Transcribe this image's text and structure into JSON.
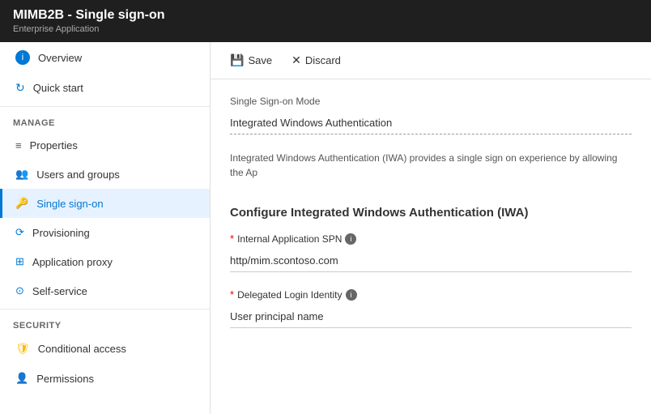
{
  "header": {
    "title": "MIMB2B - Single sign-on",
    "subtitle": "Enterprise Application"
  },
  "toolbar": {
    "save_label": "Save",
    "discard_label": "Discard"
  },
  "sidebar": {
    "items_top": [
      {
        "id": "overview",
        "label": "Overview",
        "icon": "info",
        "active": false
      },
      {
        "id": "quickstart",
        "label": "Quick start",
        "icon": "quickstart",
        "active": false
      }
    ],
    "manage_label": "MANAGE",
    "items_manage": [
      {
        "id": "properties",
        "label": "Properties",
        "icon": "bars",
        "active": false
      },
      {
        "id": "users-groups",
        "label": "Users and groups",
        "icon": "people",
        "active": false
      },
      {
        "id": "single-sign-on",
        "label": "Single sign-on",
        "icon": "sso",
        "active": true
      },
      {
        "id": "provisioning",
        "label": "Provisioning",
        "icon": "sync",
        "active": false
      },
      {
        "id": "application-proxy",
        "label": "Application proxy",
        "icon": "grid",
        "active": false
      },
      {
        "id": "self-service",
        "label": "Self-service",
        "icon": "selfservice",
        "active": false
      }
    ],
    "security_label": "SECURITY",
    "items_security": [
      {
        "id": "conditional-access",
        "label": "Conditional access",
        "icon": "shield",
        "active": false
      },
      {
        "id": "permissions",
        "label": "Permissions",
        "icon": "people2",
        "active": false
      }
    ]
  },
  "main": {
    "sso_mode_label": "Single Sign-on Mode",
    "sso_mode_value": "Integrated Windows Authentication",
    "description": "Integrated Windows Authentication (IWA) provides a single sign on experience by allowing the Ap",
    "configure_title": "Configure Integrated Windows Authentication (IWA)",
    "internal_spn_label": "Internal Application SPN",
    "internal_spn_value": "http/mim.scontoso.com",
    "delegated_login_label": "Delegated Login Identity",
    "delegated_login_value": "User principal name"
  }
}
